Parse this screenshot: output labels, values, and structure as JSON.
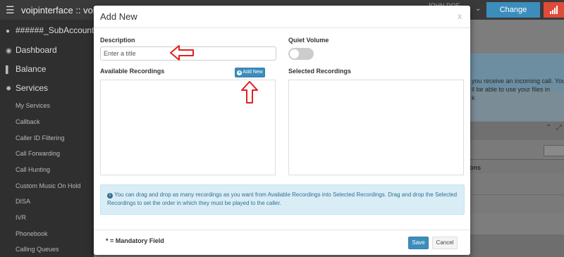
{
  "app": {
    "title": "voipinterface :: voip se",
    "user": "JOHN DOE",
    "change_account_label": "Change Account"
  },
  "sidebar": {
    "account": "######_SubAccount",
    "items": [
      {
        "label": "Dashboard",
        "icon": "dashboard-icon"
      },
      {
        "label": "Balance",
        "icon": "bar-chart-icon"
      },
      {
        "label": "Services",
        "icon": "gear-icon"
      }
    ],
    "sub_items": [
      "My Services",
      "Callback",
      "Caller ID Filtering",
      "Call Forwarding",
      "Call Hunting",
      "Custom Music On Hold",
      "DISA",
      "IVR",
      "Phonebook",
      "Calling Queues"
    ]
  },
  "background": {
    "text_line1": "you receive an incoming call. You",
    "text_line2": "ll be able to use your files in",
    "text_line3": "k",
    "column_fragment": "ons"
  },
  "modal": {
    "title": "Add New",
    "close": "x",
    "description_label": "Description",
    "description_placeholder": "Enter a title",
    "description_value": "",
    "quiet_volume_label": "Quiet Volume",
    "quiet_volume_on": false,
    "available_label": "Available Recordings",
    "add_new_label": "Add New",
    "selected_label": "Selected Recordings",
    "available_recordings": [],
    "selected_recordings": [],
    "info_text": "You can drag and drop as many recordings as you want from Available Recordings into Selected Recordings. Drag and drop the Selected Recordings to set the order in which they must be played to the caller.",
    "mandatory_note": "* = Mandatory Field",
    "save_label": "Save",
    "cancel_label": "Cancel"
  },
  "colors": {
    "primary": "#3c8dbc",
    "danger": "#dd4b39",
    "info_bg": "#d9edf7",
    "info_text": "#31708f",
    "annotation_arrow": "#e02020"
  }
}
